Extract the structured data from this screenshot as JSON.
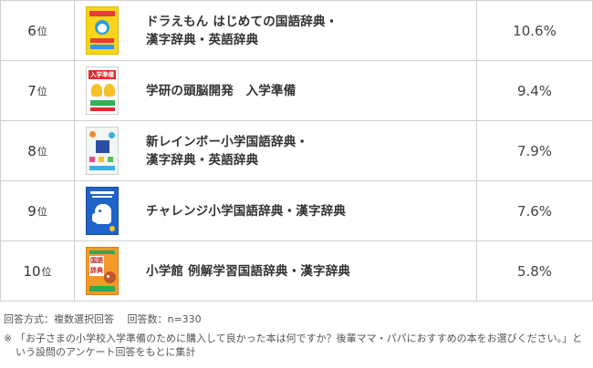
{
  "rows": [
    {
      "rank": "6",
      "suffix": "位",
      "title": "ドラえもん はじめての国語辞典・\n漢字辞典・英語辞典",
      "percent": "10.6%",
      "cover_icon": "doraemon-dictionary-cover-icon"
    },
    {
      "rank": "7",
      "suffix": "位",
      "title": "学研の頭脳開発　入学準備",
      "percent": "9.4%",
      "cover_icon": "gakken-nyugaku-junbi-cover-icon",
      "cover_text": "入学準備"
    },
    {
      "rank": "8",
      "suffix": "位",
      "title": "新レインボー小学国語辞典・\n漢字辞典・英語辞典",
      "percent": "7.9%",
      "cover_icon": "rainbow-dictionary-cover-icon"
    },
    {
      "rank": "9",
      "suffix": "位",
      "title": "チャレンジ小学国語辞典・漢字辞典",
      "percent": "7.6%",
      "cover_icon": "challenge-dictionary-cover-icon"
    },
    {
      "rank": "10",
      "suffix": "位",
      "title": "小学館 例解学習国語辞典・漢字辞典",
      "percent": "5.8%",
      "cover_icon": "shogakukan-dictionary-cover-icon",
      "cover_text": "国語辞典"
    }
  ],
  "notes": {
    "method": "回答方式：複数選択回答　 回答数：n=330",
    "mark": "※",
    "survey": "「お子さまの小学校入学準備のために購入して良かった本は何ですか？後輩ママ・パパにおすすめの本をお選びください。」という設問のアンケート回答をもとに集計"
  },
  "colors": {
    "border": "#cfcfcf",
    "text": "#333333",
    "note": "#555555"
  }
}
